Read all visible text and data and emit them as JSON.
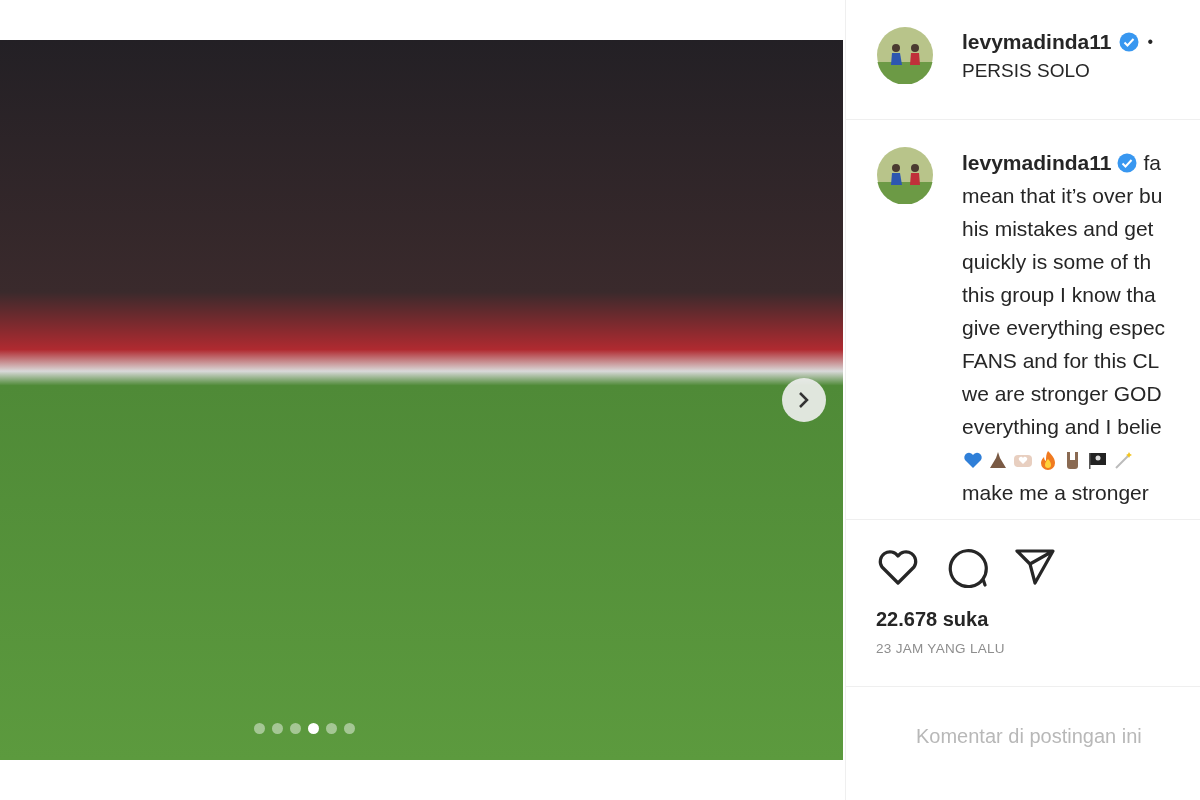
{
  "media": {
    "next_button": true,
    "slides": [
      {
        "selected": false
      },
      {
        "selected": false
      },
      {
        "selected": false
      },
      {
        "selected": true
      },
      {
        "selected": false
      },
      {
        "selected": false
      }
    ]
  },
  "header": {
    "username": "levymadinda11",
    "verified": true,
    "separator": "•",
    "location": "PERSIS SOLO"
  },
  "caption": {
    "username": "levymadinda11",
    "verified": true,
    "first_text": "fa",
    "lines": [
      {
        "kind": "text",
        "text": "mean that it’s over bu"
      },
      {
        "kind": "text",
        "text": "his mistakes and get"
      },
      {
        "kind": "text",
        "text": "quickly is some of th"
      },
      {
        "kind": "text",
        "text": "this group I know tha"
      },
      {
        "kind": "text",
        "text": "give everything espec"
      },
      {
        "kind": "text",
        "text": "FANS and for this CL"
      },
      {
        "kind": "text",
        "text": "we are stronger GOD"
      },
      {
        "kind": "text",
        "text": "everything and I belie"
      },
      {
        "kind": "emoji",
        "icons": [
          {
            "kind": "heart"
          },
          {
            "kind": "pray"
          },
          {
            "kind": "handheart"
          },
          {
            "kind": "fire"
          },
          {
            "kind": "rock"
          },
          {
            "kind": "flag"
          },
          {
            "kind": "wand"
          }
        ]
      },
      {
        "kind": "text",
        "text": "make me a stronger"
      }
    ]
  },
  "actions": [
    {
      "kind": "like"
    },
    {
      "kind": "comment"
    },
    {
      "kind": "share"
    }
  ],
  "likes": "22.678 suka",
  "time": "23 JAM YANG LALU",
  "comments_notice": "Komentar di postingan ini"
}
